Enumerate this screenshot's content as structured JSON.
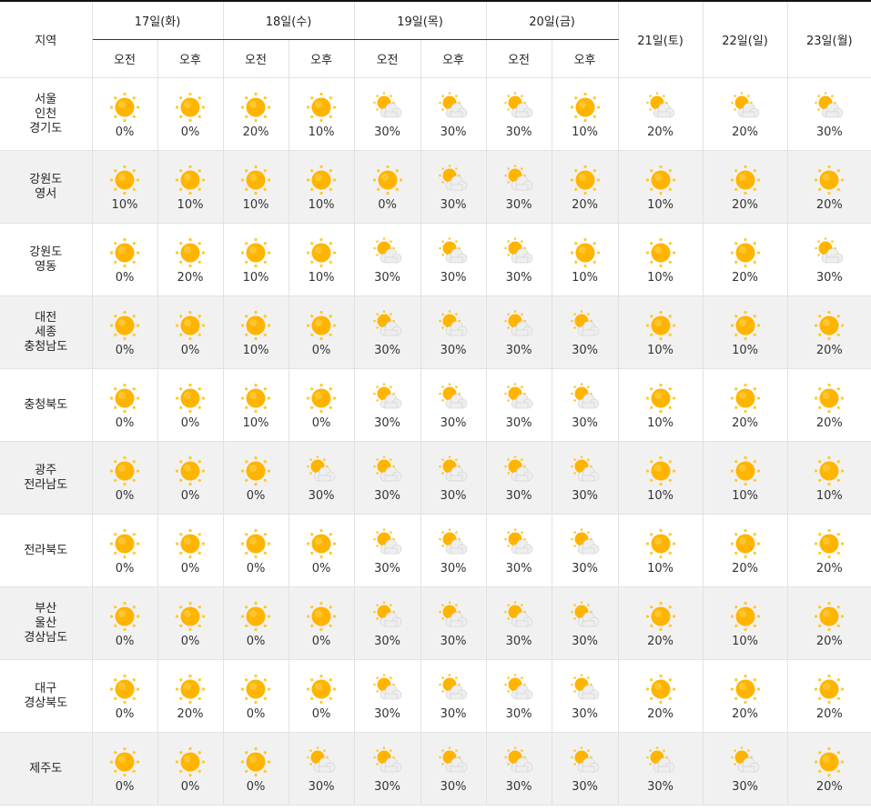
{
  "header": {
    "region_label": "지역",
    "days2": [
      {
        "label": "17일(화)",
        "am": "오전",
        "pm": "오후"
      },
      {
        "label": "18일(수)",
        "am": "오전",
        "pm": "오후"
      },
      {
        "label": "19일(목)",
        "am": "오전",
        "pm": "오후"
      },
      {
        "label": "20일(금)",
        "am": "오전",
        "pm": "오후"
      }
    ],
    "days1": [
      "21일(토)",
      "22일(일)",
      "23일(월)"
    ]
  },
  "icons": {
    "sun": "sun-icon",
    "partly_cloudy": "partly-cloudy-icon"
  },
  "colors": {
    "sun_core": "#ffb400",
    "sun_ray": "#ffc928",
    "cloud": "#eeeeee",
    "row_alt": "#f1f1f1"
  },
  "rows": [
    {
      "region": [
        "서울",
        "인천",
        "경기도"
      ],
      "cells": [
        {
          "icon": "sun",
          "pct": "0%"
        },
        {
          "icon": "sun",
          "pct": "0%"
        },
        {
          "icon": "sun",
          "pct": "20%"
        },
        {
          "icon": "sun",
          "pct": "10%"
        },
        {
          "icon": "partly_cloudy",
          "pct": "30%"
        },
        {
          "icon": "partly_cloudy",
          "pct": "30%"
        },
        {
          "icon": "partly_cloudy",
          "pct": "30%"
        },
        {
          "icon": "sun",
          "pct": "10%"
        },
        {
          "icon": "partly_cloudy",
          "pct": "20%"
        },
        {
          "icon": "partly_cloudy",
          "pct": "20%"
        },
        {
          "icon": "partly_cloudy",
          "pct": "30%"
        }
      ]
    },
    {
      "region": [
        "강원도",
        "영서"
      ],
      "cells": [
        {
          "icon": "sun",
          "pct": "10%"
        },
        {
          "icon": "sun",
          "pct": "10%"
        },
        {
          "icon": "sun",
          "pct": "10%"
        },
        {
          "icon": "sun",
          "pct": "10%"
        },
        {
          "icon": "sun",
          "pct": "0%"
        },
        {
          "icon": "partly_cloudy",
          "pct": "30%"
        },
        {
          "icon": "partly_cloudy",
          "pct": "30%"
        },
        {
          "icon": "sun",
          "pct": "20%"
        },
        {
          "icon": "sun",
          "pct": "10%"
        },
        {
          "icon": "sun",
          "pct": "20%"
        },
        {
          "icon": "sun",
          "pct": "20%"
        }
      ]
    },
    {
      "region": [
        "강원도",
        "영동"
      ],
      "cells": [
        {
          "icon": "sun",
          "pct": "0%"
        },
        {
          "icon": "sun",
          "pct": "20%"
        },
        {
          "icon": "sun",
          "pct": "10%"
        },
        {
          "icon": "sun",
          "pct": "10%"
        },
        {
          "icon": "partly_cloudy",
          "pct": "30%"
        },
        {
          "icon": "partly_cloudy",
          "pct": "30%"
        },
        {
          "icon": "partly_cloudy",
          "pct": "30%"
        },
        {
          "icon": "sun",
          "pct": "10%"
        },
        {
          "icon": "sun",
          "pct": "10%"
        },
        {
          "icon": "sun",
          "pct": "20%"
        },
        {
          "icon": "partly_cloudy",
          "pct": "30%"
        }
      ]
    },
    {
      "region": [
        "대전",
        "세종",
        "충청남도"
      ],
      "cells": [
        {
          "icon": "sun",
          "pct": "0%"
        },
        {
          "icon": "sun",
          "pct": "0%"
        },
        {
          "icon": "sun",
          "pct": "10%"
        },
        {
          "icon": "sun",
          "pct": "0%"
        },
        {
          "icon": "partly_cloudy",
          "pct": "30%"
        },
        {
          "icon": "partly_cloudy",
          "pct": "30%"
        },
        {
          "icon": "partly_cloudy",
          "pct": "30%"
        },
        {
          "icon": "partly_cloudy",
          "pct": "30%"
        },
        {
          "icon": "sun",
          "pct": "10%"
        },
        {
          "icon": "sun",
          "pct": "10%"
        },
        {
          "icon": "sun",
          "pct": "20%"
        }
      ]
    },
    {
      "region": [
        "충청북도"
      ],
      "cells": [
        {
          "icon": "sun",
          "pct": "0%"
        },
        {
          "icon": "sun",
          "pct": "0%"
        },
        {
          "icon": "sun",
          "pct": "10%"
        },
        {
          "icon": "sun",
          "pct": "0%"
        },
        {
          "icon": "partly_cloudy",
          "pct": "30%"
        },
        {
          "icon": "partly_cloudy",
          "pct": "30%"
        },
        {
          "icon": "partly_cloudy",
          "pct": "30%"
        },
        {
          "icon": "partly_cloudy",
          "pct": "30%"
        },
        {
          "icon": "sun",
          "pct": "10%"
        },
        {
          "icon": "sun",
          "pct": "20%"
        },
        {
          "icon": "sun",
          "pct": "20%"
        }
      ]
    },
    {
      "region": [
        "광주",
        "전라남도"
      ],
      "cells": [
        {
          "icon": "sun",
          "pct": "0%"
        },
        {
          "icon": "sun",
          "pct": "0%"
        },
        {
          "icon": "sun",
          "pct": "0%"
        },
        {
          "icon": "partly_cloudy",
          "pct": "30%"
        },
        {
          "icon": "partly_cloudy",
          "pct": "30%"
        },
        {
          "icon": "partly_cloudy",
          "pct": "30%"
        },
        {
          "icon": "partly_cloudy",
          "pct": "30%"
        },
        {
          "icon": "partly_cloudy",
          "pct": "30%"
        },
        {
          "icon": "sun",
          "pct": "10%"
        },
        {
          "icon": "sun",
          "pct": "10%"
        },
        {
          "icon": "sun",
          "pct": "10%"
        }
      ]
    },
    {
      "region": [
        "전라북도"
      ],
      "cells": [
        {
          "icon": "sun",
          "pct": "0%"
        },
        {
          "icon": "sun",
          "pct": "0%"
        },
        {
          "icon": "sun",
          "pct": "0%"
        },
        {
          "icon": "sun",
          "pct": "0%"
        },
        {
          "icon": "partly_cloudy",
          "pct": "30%"
        },
        {
          "icon": "partly_cloudy",
          "pct": "30%"
        },
        {
          "icon": "partly_cloudy",
          "pct": "30%"
        },
        {
          "icon": "partly_cloudy",
          "pct": "30%"
        },
        {
          "icon": "sun",
          "pct": "10%"
        },
        {
          "icon": "sun",
          "pct": "20%"
        },
        {
          "icon": "sun",
          "pct": "20%"
        }
      ]
    },
    {
      "region": [
        "부산",
        "울산",
        "경상남도"
      ],
      "cells": [
        {
          "icon": "sun",
          "pct": "0%"
        },
        {
          "icon": "sun",
          "pct": "0%"
        },
        {
          "icon": "sun",
          "pct": "0%"
        },
        {
          "icon": "sun",
          "pct": "0%"
        },
        {
          "icon": "partly_cloudy",
          "pct": "30%"
        },
        {
          "icon": "partly_cloudy",
          "pct": "30%"
        },
        {
          "icon": "partly_cloudy",
          "pct": "30%"
        },
        {
          "icon": "partly_cloudy",
          "pct": "30%"
        },
        {
          "icon": "sun",
          "pct": "20%"
        },
        {
          "icon": "sun",
          "pct": "10%"
        },
        {
          "icon": "sun",
          "pct": "20%"
        }
      ]
    },
    {
      "region": [
        "대구",
        "경상북도"
      ],
      "cells": [
        {
          "icon": "sun",
          "pct": "0%"
        },
        {
          "icon": "sun",
          "pct": "20%"
        },
        {
          "icon": "sun",
          "pct": "0%"
        },
        {
          "icon": "sun",
          "pct": "0%"
        },
        {
          "icon": "partly_cloudy",
          "pct": "30%"
        },
        {
          "icon": "partly_cloudy",
          "pct": "30%"
        },
        {
          "icon": "partly_cloudy",
          "pct": "30%"
        },
        {
          "icon": "partly_cloudy",
          "pct": "30%"
        },
        {
          "icon": "sun",
          "pct": "20%"
        },
        {
          "icon": "sun",
          "pct": "20%"
        },
        {
          "icon": "sun",
          "pct": "20%"
        }
      ]
    },
    {
      "region": [
        "제주도"
      ],
      "cells": [
        {
          "icon": "sun",
          "pct": "0%"
        },
        {
          "icon": "sun",
          "pct": "0%"
        },
        {
          "icon": "sun",
          "pct": "0%"
        },
        {
          "icon": "partly_cloudy",
          "pct": "30%"
        },
        {
          "icon": "partly_cloudy",
          "pct": "30%"
        },
        {
          "icon": "partly_cloudy",
          "pct": "30%"
        },
        {
          "icon": "partly_cloudy",
          "pct": "30%"
        },
        {
          "icon": "partly_cloudy",
          "pct": "30%"
        },
        {
          "icon": "partly_cloudy",
          "pct": "30%"
        },
        {
          "icon": "partly_cloudy",
          "pct": "30%"
        },
        {
          "icon": "sun",
          "pct": "20%"
        }
      ]
    }
  ]
}
